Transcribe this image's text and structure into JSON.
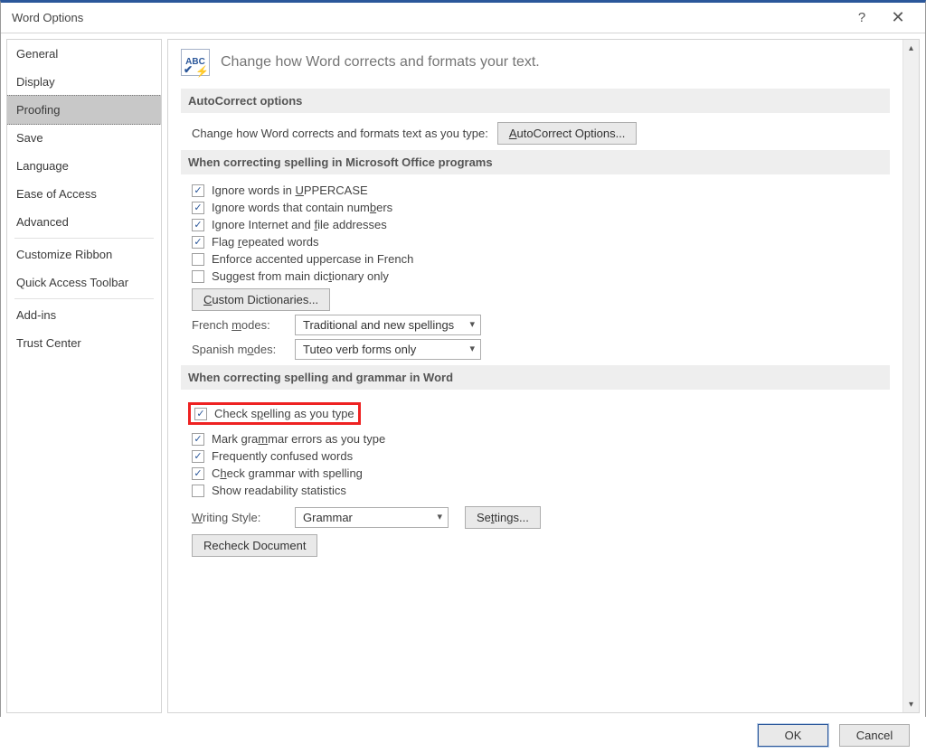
{
  "window": {
    "title": "Word Options"
  },
  "sidebar": {
    "items": [
      {
        "label": "General"
      },
      {
        "label": "Display"
      },
      {
        "label": "Proofing",
        "selected": true
      },
      {
        "label": "Save"
      },
      {
        "label": "Language"
      },
      {
        "label": "Ease of Access"
      },
      {
        "label": "Advanced"
      }
    ],
    "group2": [
      {
        "label": "Customize Ribbon"
      },
      {
        "label": "Quick Access Toolbar"
      }
    ],
    "group3": [
      {
        "label": "Add-ins"
      },
      {
        "label": "Trust Center"
      }
    ]
  },
  "page": {
    "heading": "Change how Word corrects and formats your text."
  },
  "sections": {
    "autocorrect": {
      "title": "AutoCorrect options",
      "desc": "Change how Word corrects and formats text as you type:",
      "button": "AutoCorrect Options..."
    },
    "spelling_office": {
      "title": "When correcting spelling in Microsoft Office programs",
      "checks": [
        {
          "label": "Ignore words in UPPERCASE",
          "checked": true,
          "u": "U"
        },
        {
          "label": "Ignore words that contain numbers",
          "checked": true,
          "u": "b"
        },
        {
          "label": "Ignore Internet and file addresses",
          "checked": true,
          "u": "f"
        },
        {
          "label": "Flag repeated words",
          "checked": true,
          "u": "r"
        },
        {
          "label": "Enforce accented uppercase in French",
          "checked": false
        },
        {
          "label": "Suggest from main dictionary only",
          "checked": false,
          "u": "t"
        }
      ],
      "custom_button": "Custom Dictionaries...",
      "french_label": "French modes:",
      "french_value": "Traditional and new spellings",
      "spanish_label": "Spanish modes:",
      "spanish_value": "Tuteo verb forms only"
    },
    "spelling_word": {
      "title": "When correcting spelling and grammar in Word",
      "checks": [
        {
          "label": "Check spelling as you type",
          "checked": true,
          "highlight": true,
          "u": "p"
        },
        {
          "label": "Mark grammar errors as you type",
          "checked": true,
          "u": "m"
        },
        {
          "label": "Frequently confused words",
          "checked": true
        },
        {
          "label": "Check grammar with spelling",
          "checked": true,
          "u": "h"
        },
        {
          "label": "Show readability statistics",
          "checked": false
        }
      ],
      "writing_label": "Writing Style:",
      "writing_value": "Grammar",
      "settings_button": "Settings...",
      "recheck_button": "Recheck Document"
    }
  },
  "footer": {
    "ok": "OK",
    "cancel": "Cancel"
  }
}
